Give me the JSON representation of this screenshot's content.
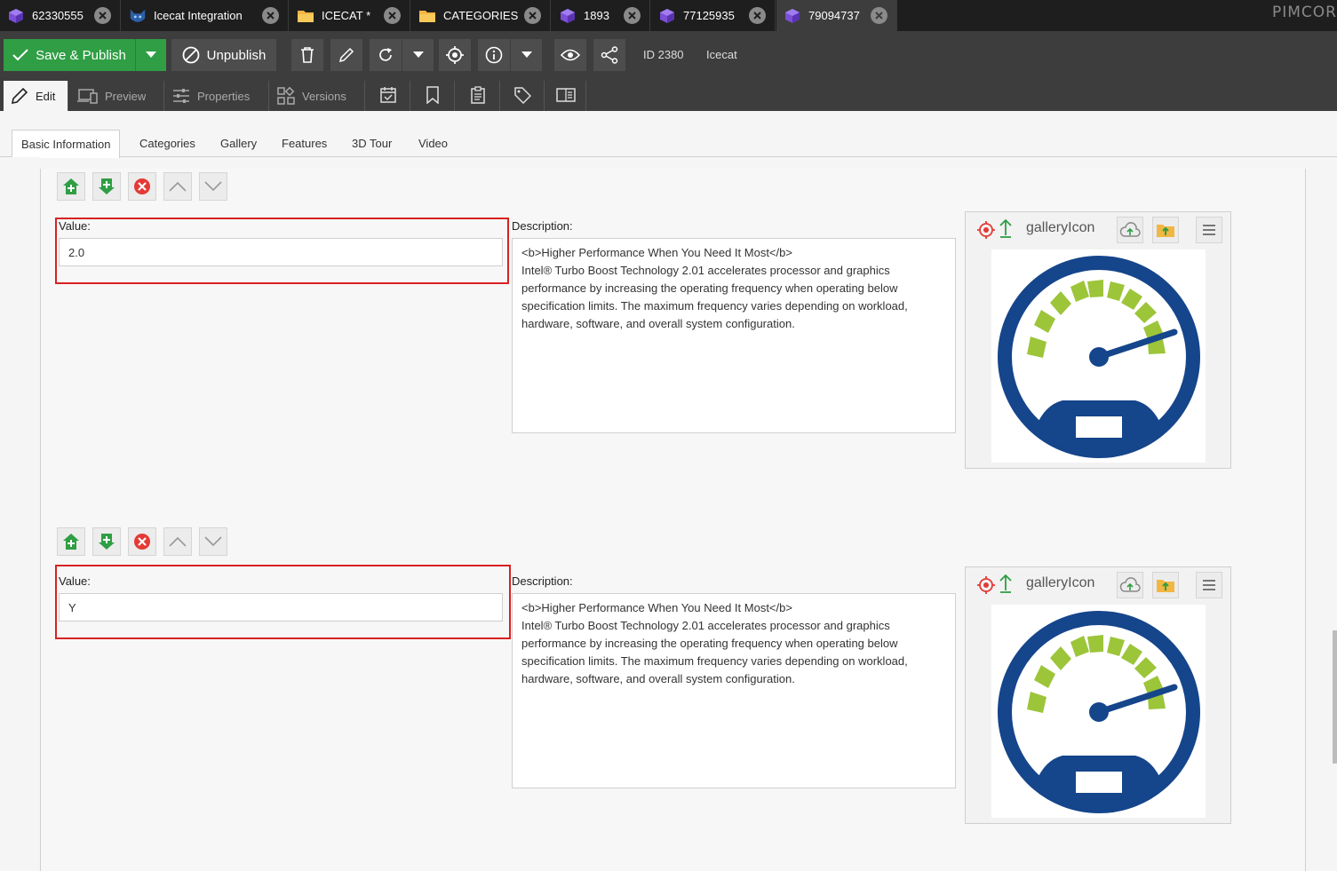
{
  "tabs": [
    {
      "label": "62330555",
      "icon": "object-cube-icon"
    },
    {
      "label": "Icecat Integration",
      "icon": "cat-icon"
    },
    {
      "label": "ICECAT *",
      "icon": "folder-icon"
    },
    {
      "label": "CATEGORIES",
      "icon": "folder-icon"
    },
    {
      "label": "1893",
      "icon": "object-cube-icon"
    },
    {
      "label": "77125935",
      "icon": "object-cube-icon"
    },
    {
      "label": "79094737",
      "icon": "object-cube-icon"
    }
  ],
  "brand": "PIMCOR",
  "toolbar": {
    "save_publish": "Save & Publish",
    "unpublish": "Unpublish",
    "id_text": "ID 2380",
    "class_text": "Icecat"
  },
  "subtabs": {
    "edit": "Edit",
    "preview": "Preview",
    "properties": "Properties",
    "versions": "Versions"
  },
  "inner_tabs": [
    "Basic Information",
    "Categories",
    "Gallery",
    "Features",
    "3D Tour",
    "Video"
  ],
  "blocks": [
    {
      "value_label": "Value:",
      "value": "2.0",
      "description_label": "Description:",
      "description_lines": [
        "<b>Higher Performance When You Need It Most</b>",
        "Intel® Turbo Boost Technology 2.01 accelerates processor and graphics",
        "performance by increasing the operating frequency when operating below",
        "specification limits. The maximum frequency varies depending on workload,",
        "hardware, software, and overall system configuration."
      ],
      "gallery_title": "galleryIcon"
    },
    {
      "value_label": "Value:",
      "value": "Y",
      "description_label": "Description:",
      "description_lines": [
        "<b>Higher Performance When You Need It Most</b>",
        "Intel® Turbo Boost Technology 2.01 accelerates processor and graphics",
        "performance by increasing the operating frequency when operating below",
        "specification limits. The maximum frequency varies depending on workload,",
        "hardware, software, and overall system configuration."
      ],
      "gallery_title": "galleryIcon"
    }
  ],
  "colors": {
    "accent_green": "#2f9e44",
    "highlight_red": "#d92121",
    "gauge_blue": "#15458b",
    "gauge_green": "#9cc53a"
  }
}
